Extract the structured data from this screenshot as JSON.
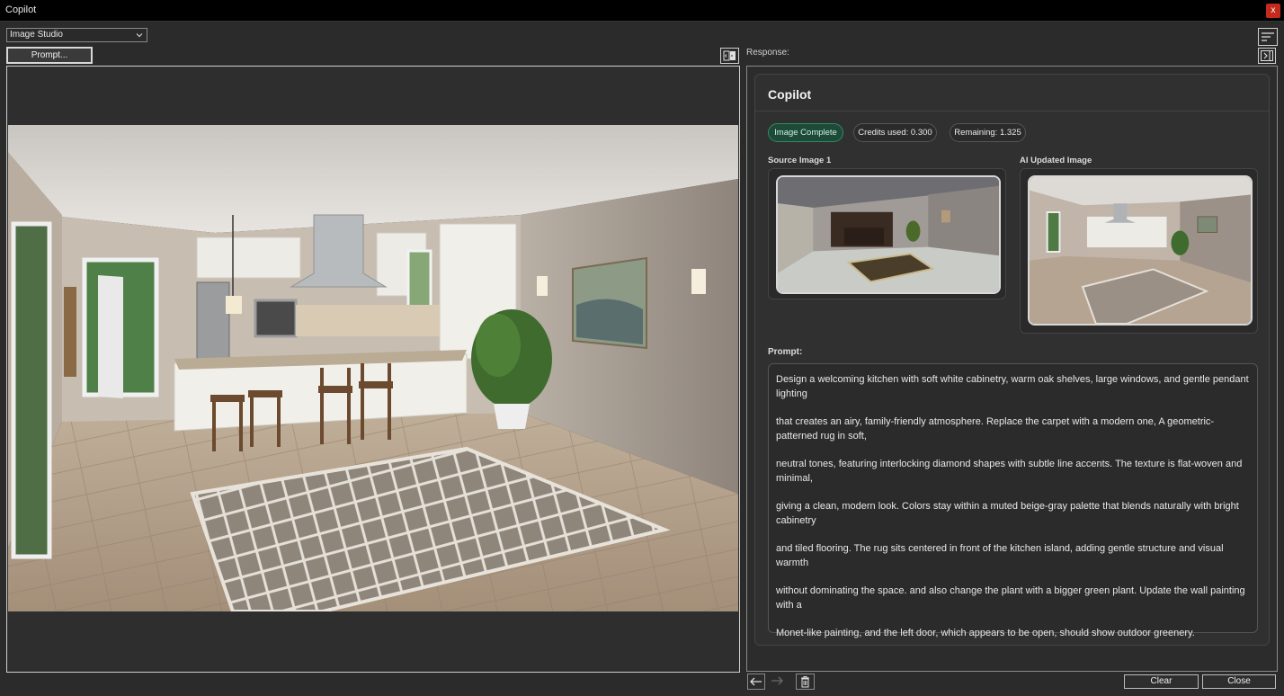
{
  "window": {
    "title": "Copilot",
    "close_glyph": "x"
  },
  "toolbar": {
    "mode_selected": "Image Studio",
    "prompt_button": "Prompt...",
    "response_label": "Response:"
  },
  "response": {
    "card_title": "Copilot",
    "status_badge": "Image Complete",
    "credits_used": "Credits used: 0.300",
    "remaining": "Remaining: 1.325",
    "source_label": "Source Image 1",
    "ai_label": "AI Updated Image",
    "prompt_label": "Prompt:",
    "prompt_paragraphs": [
      "Design a welcoming kitchen with soft white cabinetry, warm oak shelves, large windows, and gentle pendant lighting",
      "that creates an airy, family-friendly atmosphere. Replace the carpet with a modern one, A geometric-patterned rug in soft,",
      "neutral tones, featuring interlocking diamond shapes with subtle line accents. The texture is flat-woven and minimal,",
      "giving a clean, modern look. Colors stay within a muted beige-gray palette that blends naturally with bright cabinetry",
      "and tiled flooring. The rug sits centered in front of the kitchen island, adding gentle structure and visual warmth",
      "without dominating the space. and also change the plant with a bigger green plant. Update the wall painting with a",
      "Monet-like painting, and the left door, which appears to be open, should show outdoor greenery."
    ]
  },
  "footer": {
    "clear": "Clear",
    "close": "Close"
  },
  "icons": {
    "chevron": "chevron-down-icon",
    "swap": "compare-icon",
    "sort": "sort-lines-icon",
    "collapse": "collapse-panel-icon",
    "back": "arrow-left-icon",
    "forward": "arrow-right-icon",
    "trash": "trash-icon"
  },
  "colors": {
    "accent_green": "#2f8a63",
    "close_red": "#c42b1c",
    "background": "#2b2b2b"
  }
}
